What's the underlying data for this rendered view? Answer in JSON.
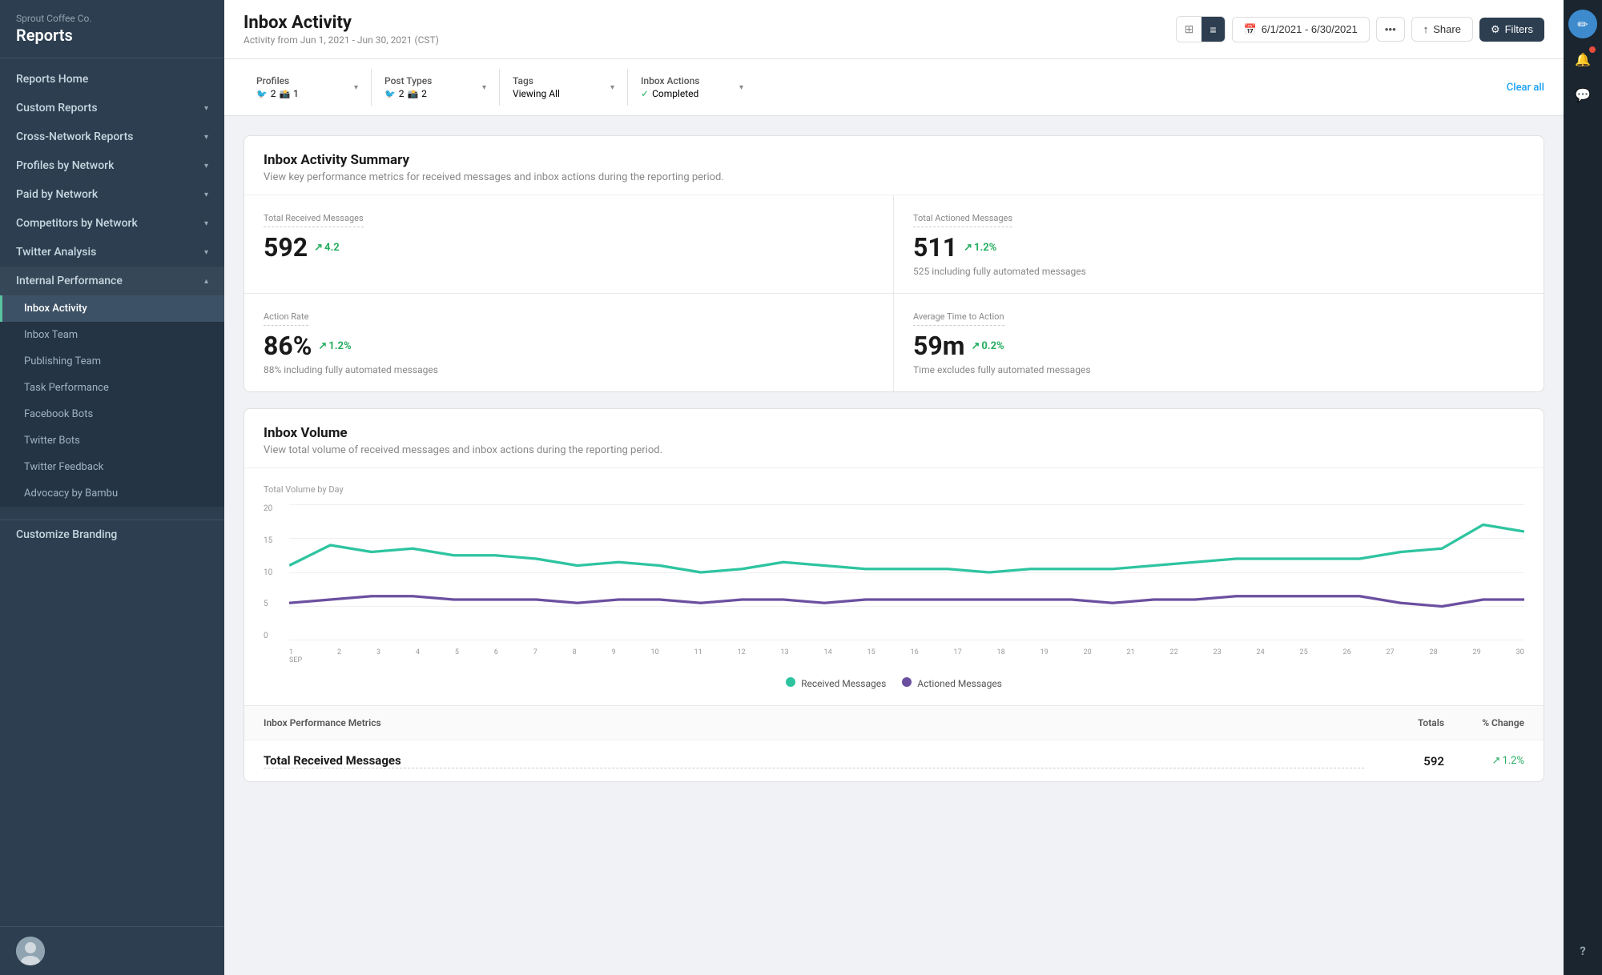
{
  "company": "Sprout Coffee Co.",
  "app_title": "Reports",
  "page_title": "Inbox Activity",
  "page_subtitle": "Activity from Jun 1, 2021 - Jun 30, 2021 (CST)",
  "date_range": "6/1/2021 - 6/30/2021",
  "header_actions": {
    "share_label": "Share",
    "filters_label": "Filters"
  },
  "filters": {
    "profiles": {
      "label": "Profiles",
      "twitter_count": "2",
      "instagram_count": "1"
    },
    "post_types": {
      "label": "Post Types",
      "twitter_count": "2",
      "instagram_count": "2"
    },
    "tags": {
      "label": "Tags",
      "value": "Viewing All"
    },
    "inbox_actions": {
      "label": "Inbox Actions",
      "value": "Completed"
    },
    "clear_all": "Clear all"
  },
  "summary": {
    "title": "Inbox Activity Summary",
    "subtitle": "View key performance metrics for received messages and inbox actions during the reporting period.",
    "metrics": [
      {
        "label": "Total Received Messages",
        "value": "592",
        "trend": "4.2",
        "trend_direction": "up",
        "sub": null
      },
      {
        "label": "Total Actioned Messages",
        "value": "511",
        "trend": "1.2%",
        "trend_direction": "up",
        "sub": "525 including fully automated messages"
      },
      {
        "label": "Action Rate",
        "value": "86%",
        "trend": "1.2%",
        "trend_direction": "up",
        "sub": "88% including fully automated messages"
      },
      {
        "label": "Average Time to Action",
        "value": "59m",
        "trend": "0.2%",
        "trend_direction": "up",
        "sub": "Time excludes fully automated messages"
      }
    ]
  },
  "volume": {
    "title": "Inbox Volume",
    "subtitle": "View total volume of received messages and inbox actions during the reporting period.",
    "chart_label": "Total Volume by Day",
    "y_labels": [
      "20",
      "15",
      "10",
      "5",
      "0"
    ],
    "x_labels": [
      "1\nSEP",
      "2",
      "3",
      "4",
      "5",
      "6",
      "7",
      "8",
      "9",
      "10",
      "11",
      "12",
      "13",
      "14",
      "15",
      "16",
      "17",
      "18",
      "19",
      "20",
      "21",
      "22",
      "23",
      "24",
      "25",
      "26",
      "27",
      "28",
      "29",
      "30"
    ],
    "legend": [
      {
        "label": "Received Messages",
        "color": "#2ec4a0"
      },
      {
        "label": "Actioned Messages",
        "color": "#6b4fa0"
      }
    ]
  },
  "table": {
    "header_label": "Inbox Performance Metrics",
    "header_totals": "Totals",
    "header_change": "% Change",
    "rows": [
      {
        "label": "Total Received Messages",
        "total": "592",
        "change": "1.2%",
        "change_direction": "up"
      }
    ]
  },
  "nav": {
    "top_items": [
      {
        "label": "Reports Home",
        "has_sub": false
      },
      {
        "label": "Custom Reports",
        "has_sub": true
      },
      {
        "label": "Cross-Network Reports",
        "has_sub": true
      },
      {
        "label": "Profiles by Network",
        "has_sub": true
      },
      {
        "label": "Paid by Network",
        "has_sub": true
      },
      {
        "label": "Competitors by Network",
        "has_sub": true
      },
      {
        "label": "Twitter Analysis",
        "has_sub": true
      },
      {
        "label": "Internal Performance",
        "has_sub": true,
        "expanded": true
      }
    ],
    "sub_items": [
      {
        "label": "Inbox Activity",
        "active": true
      },
      {
        "label": "Inbox Team"
      },
      {
        "label": "Publishing Team"
      },
      {
        "label": "Task Performance"
      },
      {
        "label": "Facebook Bots"
      },
      {
        "label": "Twitter Bots"
      },
      {
        "label": "Twitter Feedback"
      },
      {
        "label": "Advocacy by Bambu"
      }
    ],
    "footer_item": "Customize Branding"
  },
  "right_sidebar_icons": [
    {
      "name": "compose-icon",
      "symbol": "✏",
      "active": true
    },
    {
      "name": "notifications-icon",
      "symbol": "🔔",
      "badge": true
    },
    {
      "name": "messages-icon",
      "symbol": "💬"
    },
    {
      "name": "help-icon",
      "symbol": "?"
    }
  ]
}
